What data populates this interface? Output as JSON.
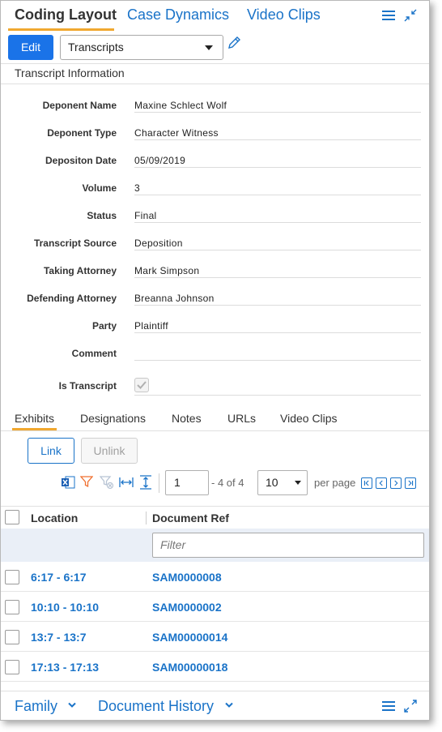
{
  "top_tabs": [
    "Coding Layout",
    "Case Dynamics",
    "Video Clips"
  ],
  "toolbar": {
    "edit_label": "Edit",
    "layout_value": "Transcripts"
  },
  "section_title": "Transcript Information",
  "fields": [
    {
      "label": "Deponent Name",
      "value": "Maxine Schlect Wolf"
    },
    {
      "label": "Deponent Type",
      "value": "Character Witness"
    },
    {
      "label": "Depositon Date",
      "value": "05/09/2019"
    },
    {
      "label": "Volume",
      "value": "3"
    },
    {
      "label": "Status",
      "value": "Final"
    },
    {
      "label": "Transcript Source",
      "value": "Deposition"
    },
    {
      "label": "Taking Attorney",
      "value": "Mark Simpson"
    },
    {
      "label": "Defending Attorney",
      "value": "Breanna Johnson"
    },
    {
      "label": "Party",
      "value": "Plaintiff"
    },
    {
      "label": "Comment",
      "value": ""
    },
    {
      "label": "Is Transcript",
      "checked": true
    }
  ],
  "sub_tabs": [
    "Exhibits",
    "Designations",
    "Notes",
    "URLs",
    "Video Clips"
  ],
  "actions": {
    "link": "Link",
    "unlink": "Unlink"
  },
  "pagination": {
    "page": "1",
    "of_text": "- 4 of 4",
    "per_page": "10",
    "per_page_label": "per page"
  },
  "grid": {
    "columns": [
      "Location",
      "Document Ref"
    ],
    "filter_placeholder": "Filter",
    "rows": [
      {
        "location": "6:17 - 6:17",
        "doc_ref": "SAM0000008"
      },
      {
        "location": "10:10 - 10:10",
        "doc_ref": "SAM0000002"
      },
      {
        "location": "13:7 - 13:7",
        "doc_ref": "SAM00000014"
      },
      {
        "location": "17:13 - 17:13",
        "doc_ref": "SAM00000018"
      }
    ]
  },
  "bottom_tabs": [
    "Family",
    "Document History"
  ],
  "colors": {
    "accent": "#1a73e8",
    "link": "#1a73c8",
    "tab_underline": "#f0a830",
    "filter_row": "#eaeff7"
  },
  "icons": [
    "menu-icon",
    "collapse-icon",
    "pencil-icon",
    "excel-export-icon",
    "filter-icon",
    "clear-filter-icon",
    "fit-columns-icon",
    "expand-rows-icon",
    "first-page-icon",
    "prev-page-icon",
    "next-page-icon",
    "last-page-icon",
    "chevron-down-icon",
    "expand-icon"
  ]
}
